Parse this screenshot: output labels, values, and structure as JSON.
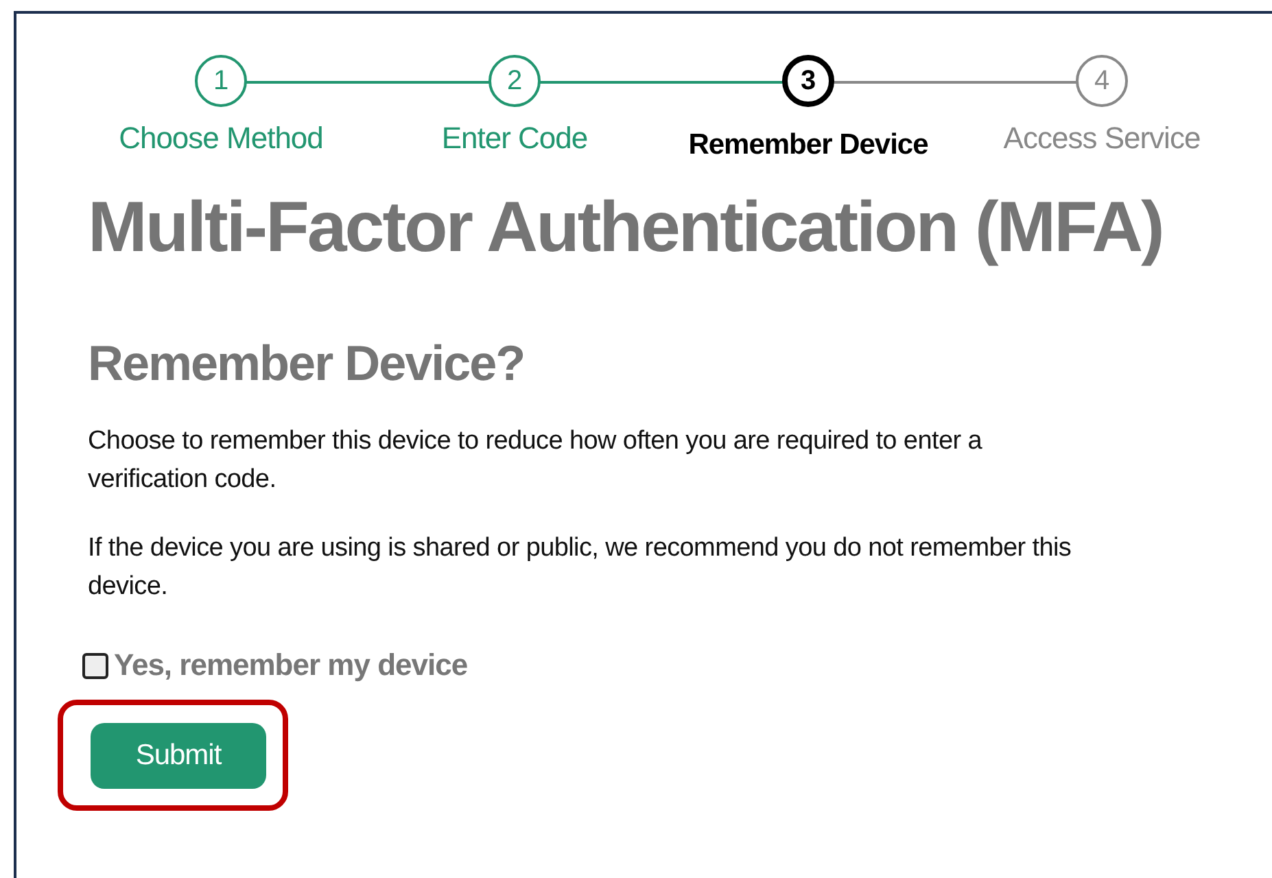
{
  "steps": [
    {
      "number": "1",
      "label": "Choose Method",
      "kind": "done"
    },
    {
      "number": "2",
      "label": "Enter Code",
      "kind": "done"
    },
    {
      "number": "3",
      "label": "Remember Device",
      "kind": "current"
    },
    {
      "number": "4",
      "label": "Access Service",
      "kind": "pending"
    }
  ],
  "title": "Multi-Factor Authentication (MFA)",
  "subtitle": "Remember Device?",
  "paragraphs": [
    "Choose to remember this device to reduce how often you are required to enter a verification code.",
    "If the device you are using is shared or public, we recommend you do not remember this device."
  ],
  "checkbox": {
    "label": "Yes, remember my device",
    "checked": false
  },
  "submit": {
    "label": "Submit",
    "highlighted": true
  }
}
